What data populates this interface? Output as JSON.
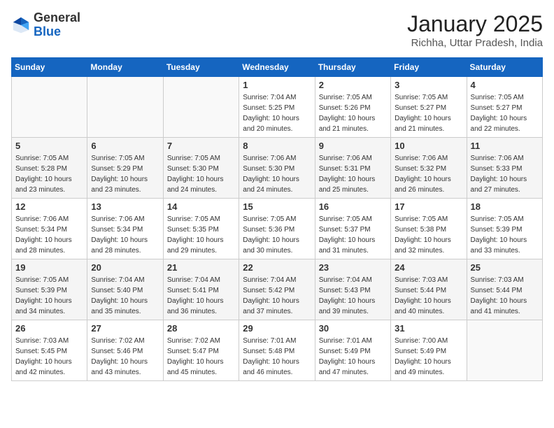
{
  "logo": {
    "general": "General",
    "blue": "Blue"
  },
  "title": "January 2025",
  "subtitle": "Richha, Uttar Pradesh, India",
  "days_of_week": [
    "Sunday",
    "Monday",
    "Tuesday",
    "Wednesday",
    "Thursday",
    "Friday",
    "Saturday"
  ],
  "weeks": [
    {
      "days": [
        {
          "num": "",
          "empty": true
        },
        {
          "num": "",
          "empty": true
        },
        {
          "num": "",
          "empty": true
        },
        {
          "num": "1",
          "sunrise": "7:04 AM",
          "sunset": "5:25 PM",
          "daylight": "10 hours and 20 minutes."
        },
        {
          "num": "2",
          "sunrise": "7:05 AM",
          "sunset": "5:26 PM",
          "daylight": "10 hours and 21 minutes."
        },
        {
          "num": "3",
          "sunrise": "7:05 AM",
          "sunset": "5:27 PM",
          "daylight": "10 hours and 21 minutes."
        },
        {
          "num": "4",
          "sunrise": "7:05 AM",
          "sunset": "5:27 PM",
          "daylight": "10 hours and 22 minutes."
        }
      ]
    },
    {
      "days": [
        {
          "num": "5",
          "sunrise": "7:05 AM",
          "sunset": "5:28 PM",
          "daylight": "10 hours and 23 minutes."
        },
        {
          "num": "6",
          "sunrise": "7:05 AM",
          "sunset": "5:29 PM",
          "daylight": "10 hours and 23 minutes."
        },
        {
          "num": "7",
          "sunrise": "7:05 AM",
          "sunset": "5:30 PM",
          "daylight": "10 hours and 24 minutes."
        },
        {
          "num": "8",
          "sunrise": "7:06 AM",
          "sunset": "5:30 PM",
          "daylight": "10 hours and 24 minutes."
        },
        {
          "num": "9",
          "sunrise": "7:06 AM",
          "sunset": "5:31 PM",
          "daylight": "10 hours and 25 minutes."
        },
        {
          "num": "10",
          "sunrise": "7:06 AM",
          "sunset": "5:32 PM",
          "daylight": "10 hours and 26 minutes."
        },
        {
          "num": "11",
          "sunrise": "7:06 AM",
          "sunset": "5:33 PM",
          "daylight": "10 hours and 27 minutes."
        }
      ]
    },
    {
      "days": [
        {
          "num": "12",
          "sunrise": "7:06 AM",
          "sunset": "5:34 PM",
          "daylight": "10 hours and 28 minutes."
        },
        {
          "num": "13",
          "sunrise": "7:06 AM",
          "sunset": "5:34 PM",
          "daylight": "10 hours and 28 minutes."
        },
        {
          "num": "14",
          "sunrise": "7:05 AM",
          "sunset": "5:35 PM",
          "daylight": "10 hours and 29 minutes."
        },
        {
          "num": "15",
          "sunrise": "7:05 AM",
          "sunset": "5:36 PM",
          "daylight": "10 hours and 30 minutes."
        },
        {
          "num": "16",
          "sunrise": "7:05 AM",
          "sunset": "5:37 PM",
          "daylight": "10 hours and 31 minutes."
        },
        {
          "num": "17",
          "sunrise": "7:05 AM",
          "sunset": "5:38 PM",
          "daylight": "10 hours and 32 minutes."
        },
        {
          "num": "18",
          "sunrise": "7:05 AM",
          "sunset": "5:39 PM",
          "daylight": "10 hours and 33 minutes."
        }
      ]
    },
    {
      "days": [
        {
          "num": "19",
          "sunrise": "7:05 AM",
          "sunset": "5:39 PM",
          "daylight": "10 hours and 34 minutes."
        },
        {
          "num": "20",
          "sunrise": "7:04 AM",
          "sunset": "5:40 PM",
          "daylight": "10 hours and 35 minutes."
        },
        {
          "num": "21",
          "sunrise": "7:04 AM",
          "sunset": "5:41 PM",
          "daylight": "10 hours and 36 minutes."
        },
        {
          "num": "22",
          "sunrise": "7:04 AM",
          "sunset": "5:42 PM",
          "daylight": "10 hours and 37 minutes."
        },
        {
          "num": "23",
          "sunrise": "7:04 AM",
          "sunset": "5:43 PM",
          "daylight": "10 hours and 39 minutes."
        },
        {
          "num": "24",
          "sunrise": "7:03 AM",
          "sunset": "5:44 PM",
          "daylight": "10 hours and 40 minutes."
        },
        {
          "num": "25",
          "sunrise": "7:03 AM",
          "sunset": "5:44 PM",
          "daylight": "10 hours and 41 minutes."
        }
      ]
    },
    {
      "days": [
        {
          "num": "26",
          "sunrise": "7:03 AM",
          "sunset": "5:45 PM",
          "daylight": "10 hours and 42 minutes."
        },
        {
          "num": "27",
          "sunrise": "7:02 AM",
          "sunset": "5:46 PM",
          "daylight": "10 hours and 43 minutes."
        },
        {
          "num": "28",
          "sunrise": "7:02 AM",
          "sunset": "5:47 PM",
          "daylight": "10 hours and 45 minutes."
        },
        {
          "num": "29",
          "sunrise": "7:01 AM",
          "sunset": "5:48 PM",
          "daylight": "10 hours and 46 minutes."
        },
        {
          "num": "30",
          "sunrise": "7:01 AM",
          "sunset": "5:49 PM",
          "daylight": "10 hours and 47 minutes."
        },
        {
          "num": "31",
          "sunrise": "7:00 AM",
          "sunset": "5:49 PM",
          "daylight": "10 hours and 49 minutes."
        },
        {
          "num": "",
          "empty": true
        }
      ]
    }
  ]
}
